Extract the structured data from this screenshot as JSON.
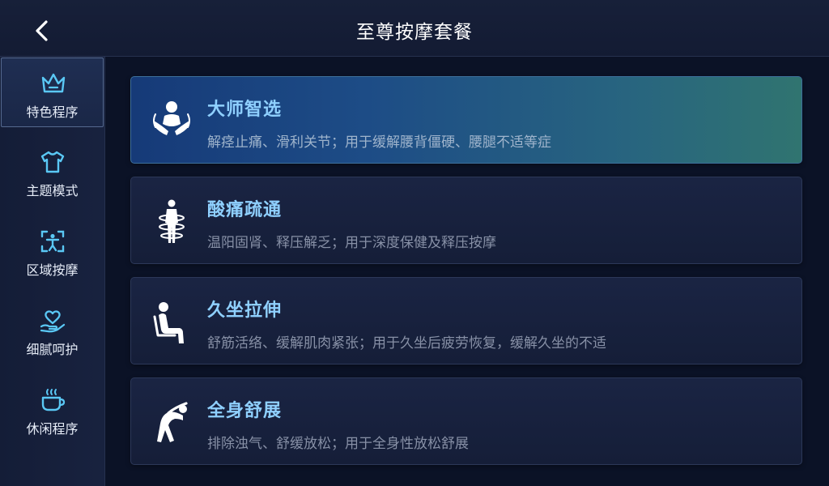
{
  "header": {
    "title": "至尊按摩套餐",
    "back_icon": "chevron-left-icon"
  },
  "sidebar": {
    "items": [
      {
        "label": "特色程序",
        "icon": "crown-icon",
        "active": true
      },
      {
        "label": "主题模式",
        "icon": "tshirt-icon",
        "active": false
      },
      {
        "label": "区域按摩",
        "icon": "body-scan-icon",
        "active": false
      },
      {
        "label": "细腻呵护",
        "icon": "heart-hand-icon",
        "active": false
      },
      {
        "label": "休闲程序",
        "icon": "coffee-cup-icon",
        "active": false
      }
    ]
  },
  "programs": [
    {
      "title": "大师智选",
      "desc": "解痉止痛、滑利关节；用于缓解腰背僵硬、腰腿不适等症",
      "icon": "massage-hands-icon",
      "selected": true
    },
    {
      "title": "酸痛疏通",
      "desc": "温阳固肾、释压解乏；用于深度保健及释压按摩",
      "icon": "body-rings-icon",
      "selected": false
    },
    {
      "title": "久坐拉伸",
      "desc": "舒筋活络、缓解肌肉紧张；用于久坐后疲劳恢复，缓解久坐的不适",
      "icon": "sitting-person-icon",
      "selected": false
    },
    {
      "title": "全身舒展",
      "desc": "排除浊气、舒缓放松；用于全身性放松舒展",
      "icon": "stretching-person-icon",
      "selected": false
    }
  ],
  "colors": {
    "accent": "#8fd0ff",
    "sidebar_icon": "#5ac8f5",
    "background": "#0b1226"
  }
}
